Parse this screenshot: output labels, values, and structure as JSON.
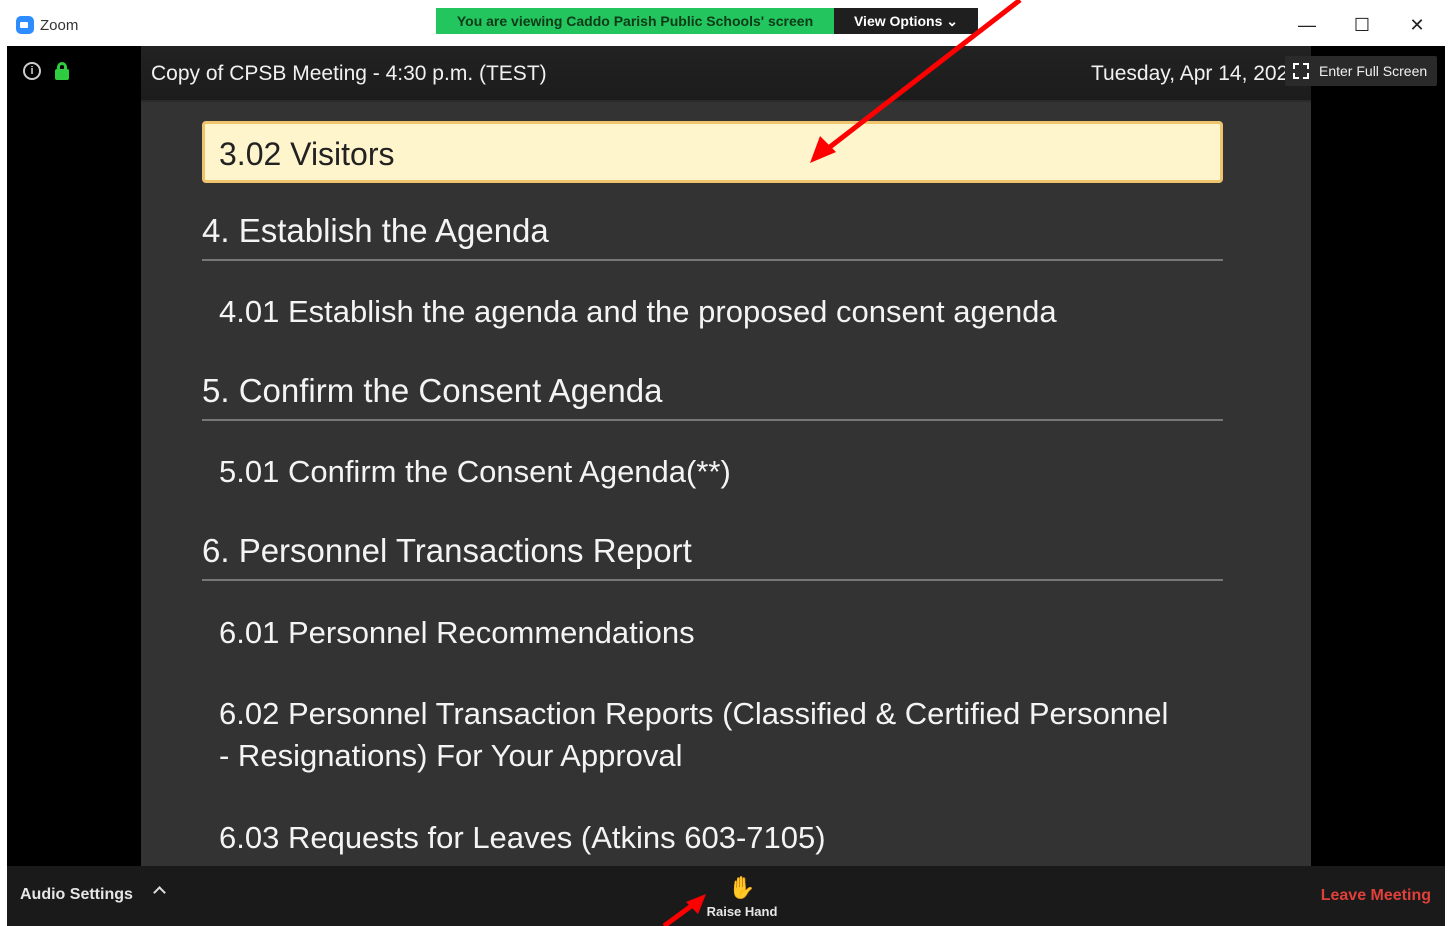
{
  "window": {
    "app_title": "Zoom",
    "share_banner": "You are viewing Caddo Parish Public Schools' screen",
    "view_options": "View Options ⌄",
    "minimize": "—",
    "maximize": "☐",
    "close": "✕"
  },
  "meeting": {
    "title": "Copy of CPSB Meeting - 4:30 p.m. (TEST)",
    "date": "Tuesday, Apr 14, 2020",
    "fullscreen_label": "Enter Full Screen"
  },
  "agenda": {
    "highlighted": "3.02 Visitors",
    "sections": [
      {
        "heading": "4. Establish the Agenda",
        "items": [
          "4.01 Establish the agenda and the proposed consent agenda"
        ]
      },
      {
        "heading": "5. Confirm the Consent Agenda",
        "items": [
          "5.01 Confirm the Consent Agenda(**)"
        ]
      },
      {
        "heading": "6. Personnel Transactions Report",
        "items": [
          "6.01 Personnel Recommendations",
          "6.02 Personnel Transaction Reports (Classified & Certified Personnel",
          "- Resignations) For Your Approval",
          "6.03 Requests for Leaves (Atkins 603-7105)"
        ]
      }
    ]
  },
  "toolbar": {
    "audio_settings": "Audio Settings",
    "raise_hand": "Raise Hand",
    "leave_meeting": "Leave Meeting"
  },
  "colors": {
    "share_banner": "#23c55e",
    "highlight_bg": "#fff5cc",
    "highlight_border": "#f0c36d",
    "leave": "#e0403a",
    "annotation_arrow": "#ff0000"
  },
  "icons": [
    "zoom-app-icon",
    "info-icon",
    "lock-icon",
    "fullscreen-icon",
    "caret-up-icon",
    "hand-icon"
  ]
}
